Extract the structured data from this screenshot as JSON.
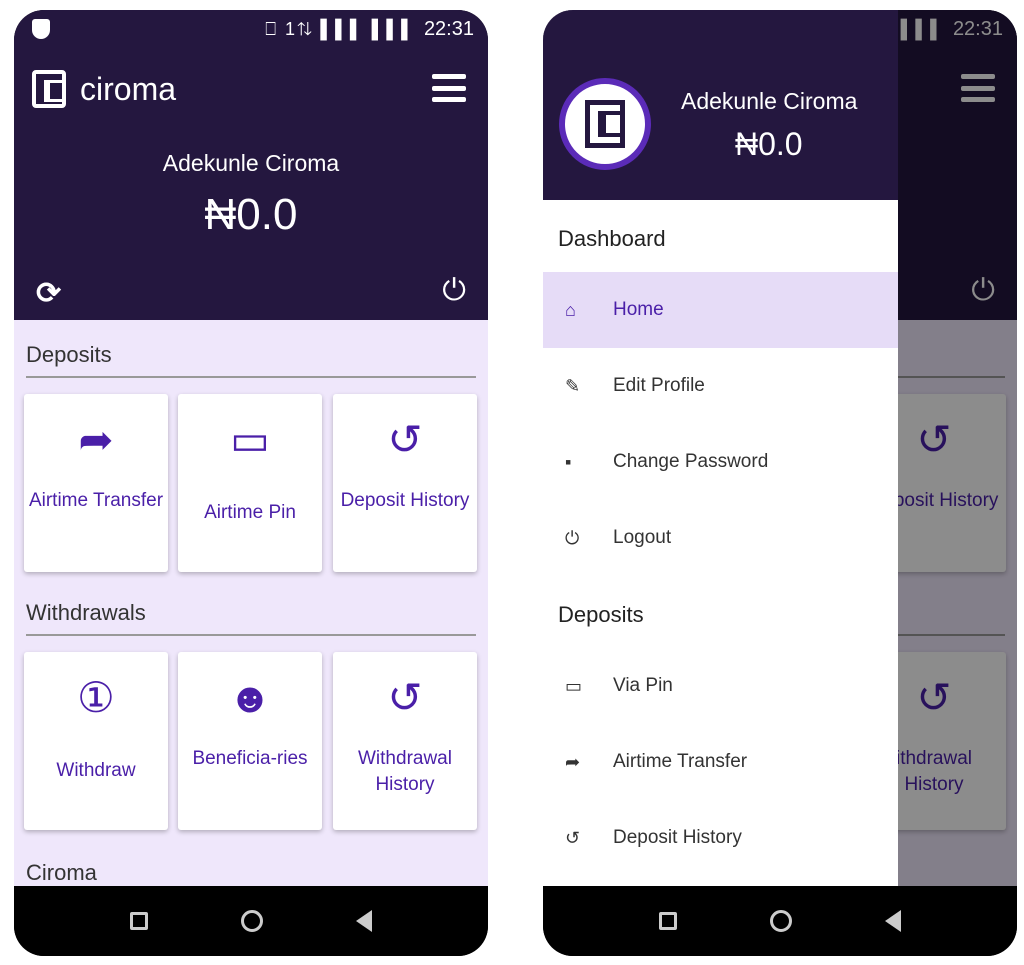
{
  "status": {
    "time": "22:31",
    "icons": "⎕ 1⇅ ▌▌▌ ▌▌▌"
  },
  "app": {
    "title": "ciroma"
  },
  "user": {
    "name": "Adekunle Ciroma",
    "balance": "₦0.0"
  },
  "deposits": {
    "title": "Deposits",
    "cards": [
      {
        "icon": "share-arrow-icon",
        "glyph": "➦",
        "label": "Airtime Transfer"
      },
      {
        "icon": "credit-card-icon",
        "glyph": "▭",
        "label": "Airtime Pin"
      },
      {
        "icon": "history-icon",
        "glyph": "↺",
        "label": "Deposit History"
      }
    ]
  },
  "withdrawals": {
    "title": "Withdrawals",
    "cards": [
      {
        "icon": "money-icon",
        "glyph": "①",
        "label": "Withdraw"
      },
      {
        "icon": "users-icon",
        "glyph": "☻",
        "label": "Beneficia-ries"
      },
      {
        "icon": "history-icon",
        "glyph": "↺",
        "label": "Withdrawal History"
      }
    ]
  },
  "ciroma_section": {
    "title": "Ciroma"
  },
  "drawer": {
    "sections": [
      {
        "title": "Dashboard",
        "items": [
          {
            "icon": "home-icon",
            "glyph": "⌂",
            "label": "Home",
            "active": true
          },
          {
            "icon": "edit-icon",
            "glyph": "✎",
            "label": "Edit Profile"
          },
          {
            "icon": "lock-icon",
            "glyph": "▪",
            "label": "Change Password"
          },
          {
            "icon": "power-icon",
            "glyph": "⏻",
            "label": "Logout"
          }
        ]
      },
      {
        "title": "Deposits",
        "items": [
          {
            "icon": "credit-card-icon",
            "glyph": "▭",
            "label": "Via Pin"
          },
          {
            "icon": "share-arrow-icon",
            "glyph": "➦",
            "label": "Airtime Transfer"
          },
          {
            "icon": "history-icon",
            "glyph": "↺",
            "label": "Deposit History"
          }
        ]
      }
    ]
  },
  "behind": {
    "deposit_label": "Deposit History",
    "withdrawal_label": "ithdrawal History"
  },
  "colors": {
    "header": "#24173f",
    "accent": "#4a1fa8",
    "content_bg": "#efe7fb",
    "active_bg": "#e6dcf7"
  }
}
